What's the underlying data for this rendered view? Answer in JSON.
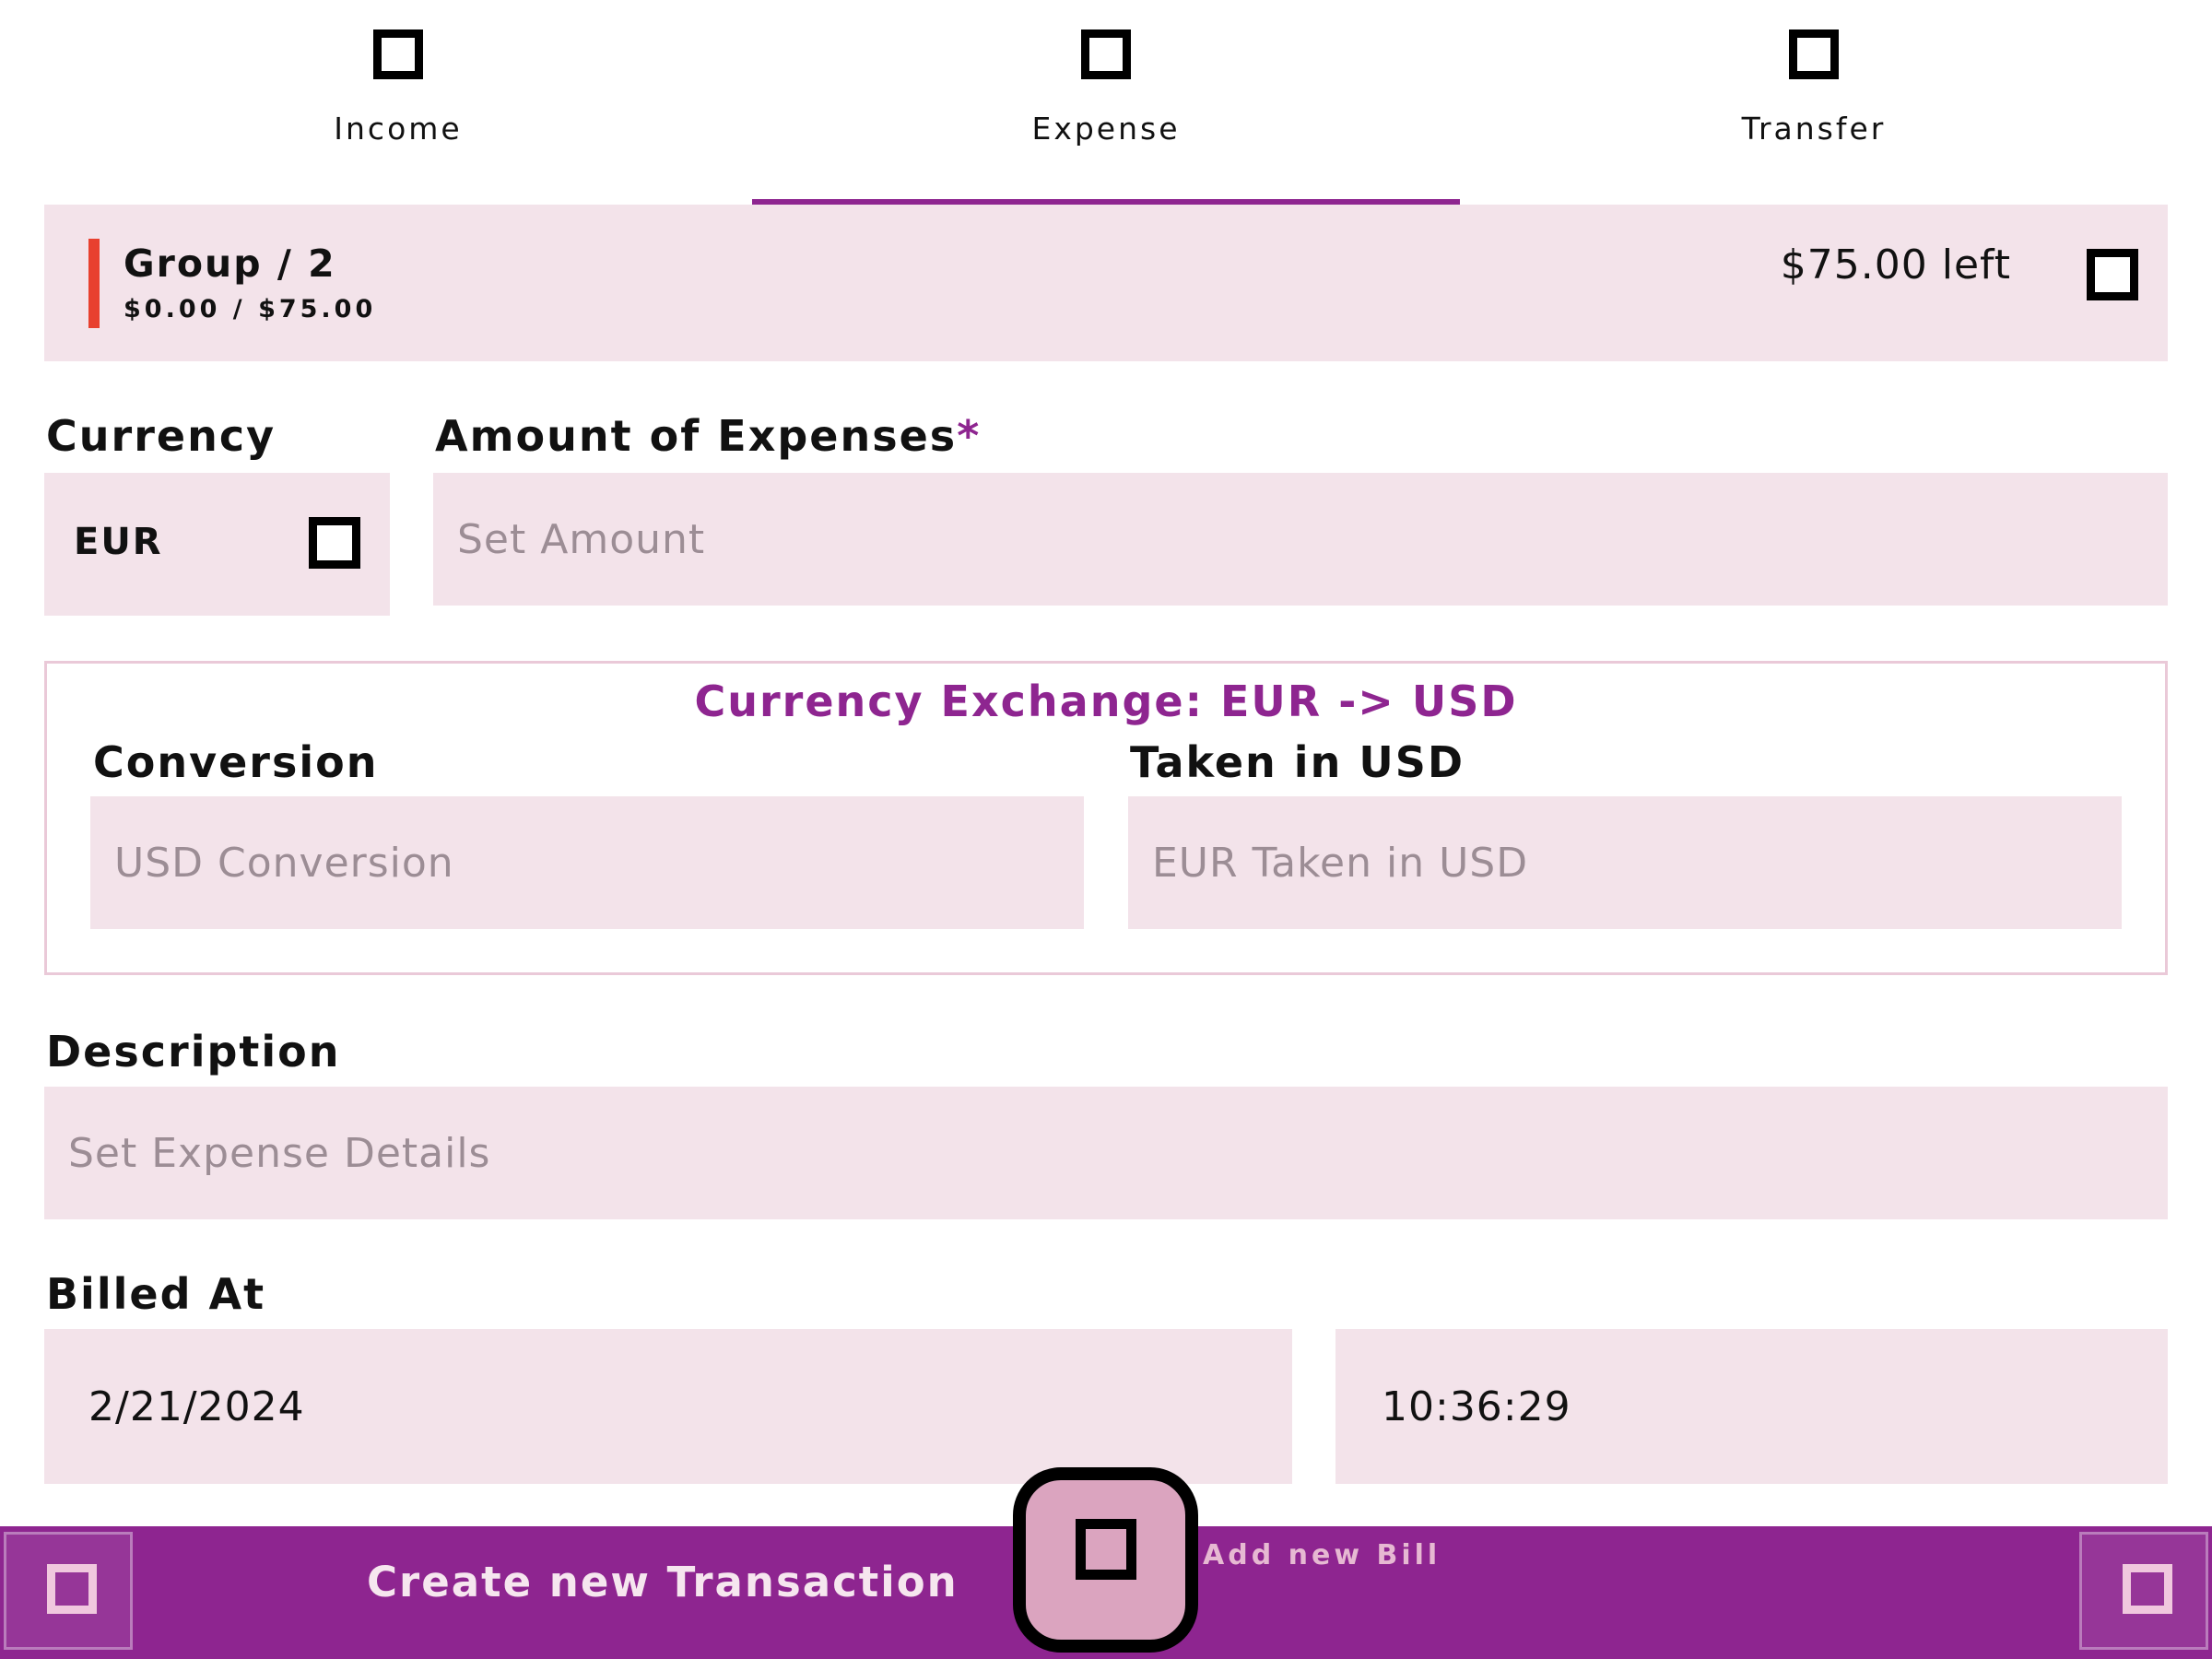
{
  "tabs": [
    {
      "label": "Income",
      "icon": "income-icon",
      "active": false
    },
    {
      "label": "Expense",
      "icon": "expense-icon",
      "active": true
    },
    {
      "label": "Transfer",
      "icon": "transfer-icon",
      "active": false
    }
  ],
  "budget": {
    "group_name": "Group / 2",
    "progress": "$0.00 / $75.00",
    "remaining": "$75.00 left",
    "stripe_color": "#e8402f"
  },
  "form": {
    "currency_label": "Currency",
    "currency_value": "EUR",
    "amount_label": "Amount of Expenses",
    "amount_required_marker": "*",
    "amount_placeholder": "Set Amount",
    "exchange_title": "Currency Exchange: EUR -> USD",
    "conversion_label": "Conversion",
    "conversion_placeholder": "USD Conversion",
    "taken_label": "Taken in USD",
    "taken_placeholder": "EUR Taken in USD",
    "description_label": "Description",
    "description_placeholder": "Set Expense Details",
    "billed_at_label": "Billed At",
    "date_value": "2/21/2024",
    "time_value": "10:36:29"
  },
  "bottom_bar": {
    "create_label": "Create new Transaction",
    "add_bill_label": "Add new Bill"
  },
  "colors": {
    "accent": "#8e2590",
    "field_bg": "#f3e3ea",
    "fab_bg": "#dba4bf"
  }
}
